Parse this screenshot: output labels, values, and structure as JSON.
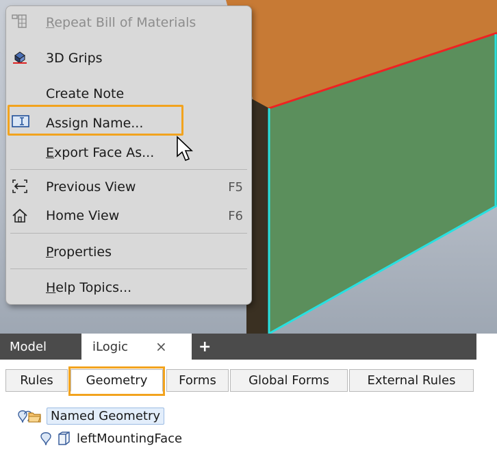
{
  "context_menu": {
    "items": [
      {
        "label": "Repeat Bill of Materials",
        "icon": "bill-of-materials-icon",
        "disabled": true
      },
      {
        "label": "3D Grips",
        "icon": "3d-grips-icon"
      },
      {
        "label": "Create Note"
      },
      {
        "label": "Assign Name...",
        "icon": "assign-name-icon"
      },
      {
        "label": "Export Face As..."
      },
      {
        "label": "Previous View",
        "icon": "previous-view-icon",
        "shortcut": "F5"
      },
      {
        "label": "Home View",
        "icon": "home-icon",
        "shortcut": "F6"
      },
      {
        "label": "Properties"
      },
      {
        "label": "Help Topics..."
      }
    ]
  },
  "document_tabs": {
    "model": "Model",
    "ilogic": "iLogic",
    "close": "×",
    "add": "+"
  },
  "ilogic_tabs": [
    "Rules",
    "Geometry",
    "Forms",
    "Global Forms",
    "External Rules"
  ],
  "active_ilogic_tab": "Geometry",
  "tree": {
    "root": "Named Geometry",
    "children": [
      "leftMountingFace"
    ]
  },
  "colors": {
    "highlight": "#f2a31e",
    "face_top": "#c77a35",
    "face_front": "#5b8f5c",
    "edge_selected": "#ee2222",
    "edge_cyan": "#28e0e0"
  }
}
